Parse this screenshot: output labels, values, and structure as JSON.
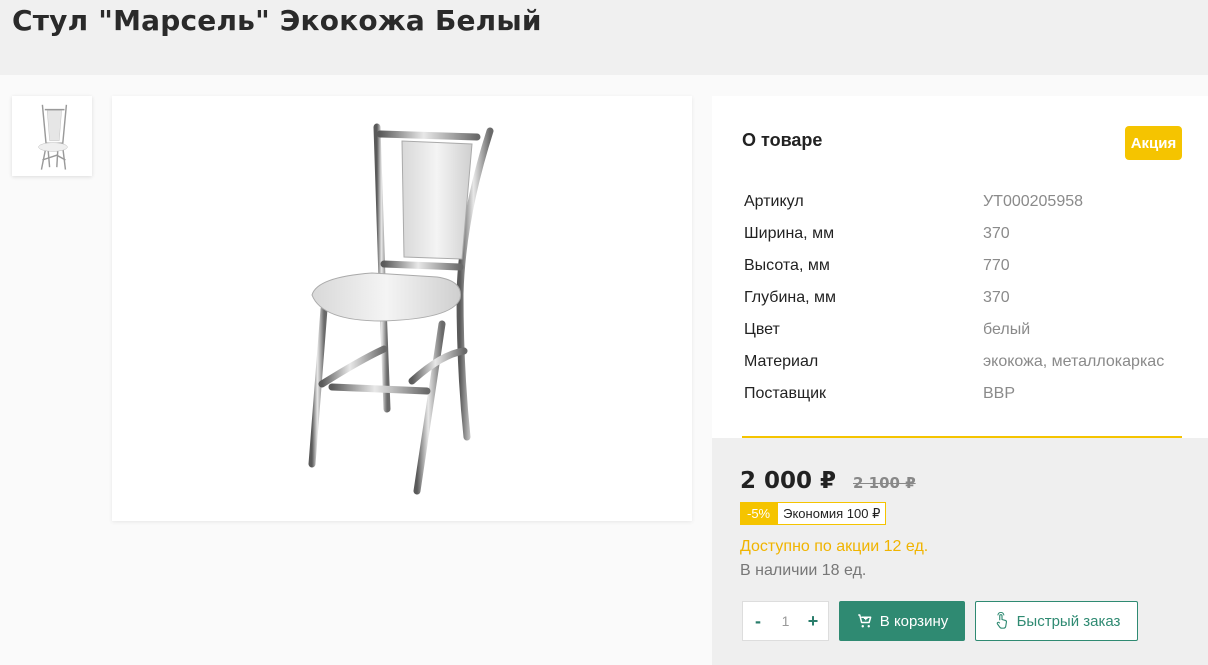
{
  "product": {
    "title": "Стул \"Марсель\" Экокожа Белый"
  },
  "info": {
    "heading": "О товаре",
    "badge": "Акция",
    "specs": [
      {
        "label": "Артикул",
        "value": "УТ000205958"
      },
      {
        "label": "Ширина, мм",
        "value": "370"
      },
      {
        "label": "Высота, мм",
        "value": "770"
      },
      {
        "label": "Глубина, мм",
        "value": "370"
      },
      {
        "label": "Цвет",
        "value": "белый"
      },
      {
        "label": "Материал",
        "value": "экокожа, металлокаркас"
      },
      {
        "label": "Поставщик",
        "value": "ВВР"
      }
    ]
  },
  "pricing": {
    "current": "2 000 ₽",
    "old": "2 100 ₽",
    "discount_pct": "-5%",
    "savings": "Экономия 100 ₽",
    "avail_promo": "Доступно по акции 12 ед.",
    "avail_stock": "В наличии 18 ед."
  },
  "cart": {
    "minus": "-",
    "quantity": "1",
    "plus": "+",
    "add_label": "В корзину",
    "quick_label": "Быстрый заказ"
  },
  "colors": {
    "accent": "#f5c400",
    "brand": "#2f8a72"
  }
}
